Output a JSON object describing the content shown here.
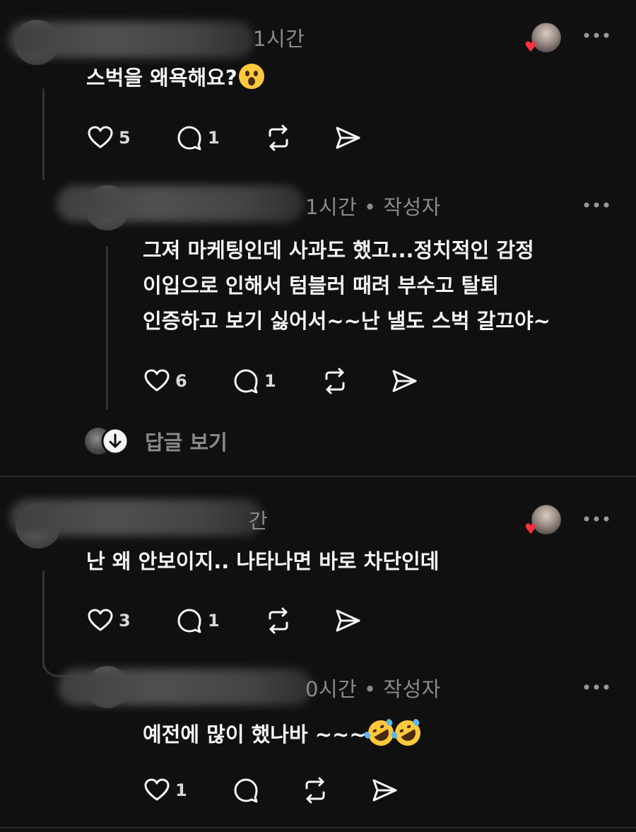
{
  "colors": {
    "background": "#101010",
    "text_primary": "#f3f5f7",
    "text_secondary": "#8a8a8a",
    "heart": "#ff3040",
    "divider": "#262626"
  },
  "comments": [
    {
      "time": "1시간",
      "author_tag": "",
      "text_lines": [
        "스벅을 왜욕해요?"
      ],
      "emoji": "astonished-face",
      "likes": "5",
      "replies": "1",
      "liked_by_author": true
    },
    {
      "time": "1시간",
      "author_tag": "작성자",
      "text_lines": [
        "그져 마케팅인데 사과도 했고...정치적인 감정",
        "이입으로 인해서 텀블러 때려 부수고 탈퇴",
        "인증하고 보기 싫어서~~난 낼도 스벅 갈끄야~"
      ],
      "likes": "6",
      "replies": "1"
    },
    {
      "time": "간",
      "author_tag": "",
      "text_lines": [
        "난 왜 안보이지.. 나타나면 바로 차단인데"
      ],
      "likes": "3",
      "replies": "1",
      "liked_by_author": true
    },
    {
      "time": "0시간",
      "author_tag": "작성자",
      "text_lines": [
        "예전에 많이 했나바 ~~~"
      ],
      "emoji": "rolling-on-the-floor-laughing",
      "likes": "1",
      "replies": ""
    }
  ],
  "view_replies_label": "답글 보기",
  "separator_dot": "•",
  "icons": [
    "heart-icon",
    "comment-icon",
    "repost-icon",
    "share-icon",
    "more-icon",
    "down-arrow-icon"
  ]
}
